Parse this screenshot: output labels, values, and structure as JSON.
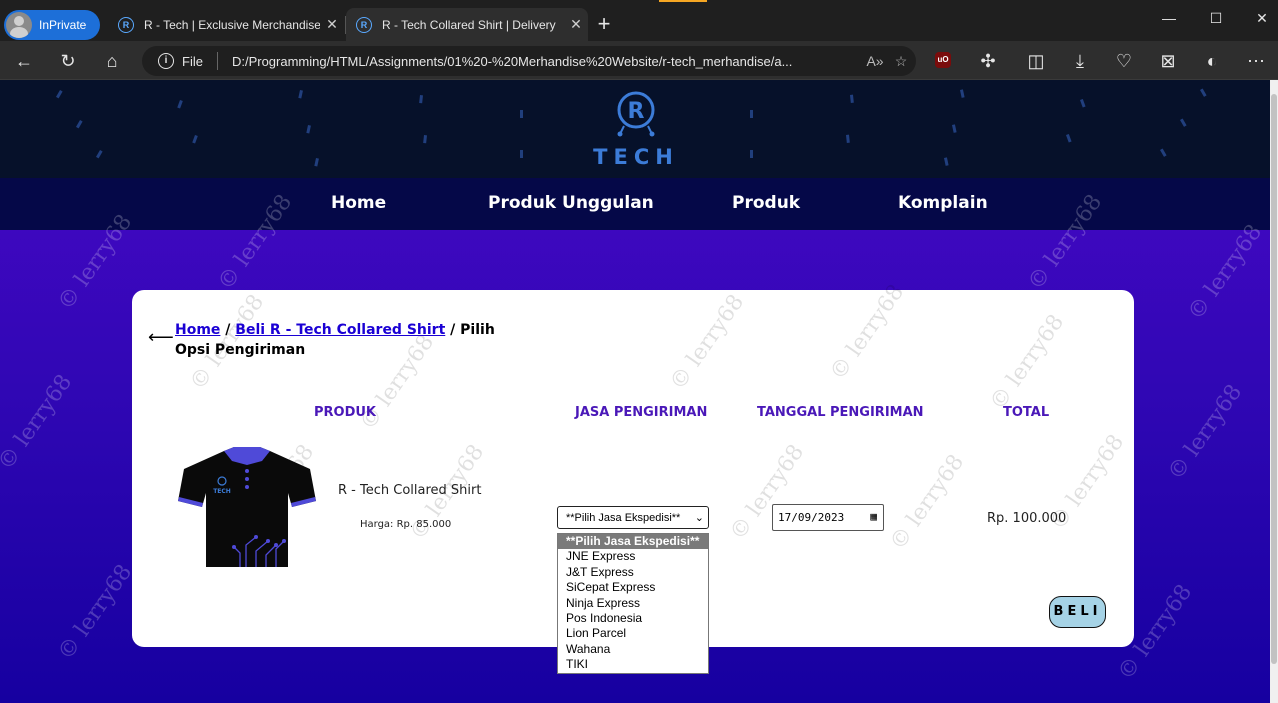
{
  "browser": {
    "inprivate_label": "InPrivate",
    "tabs": [
      {
        "title": "R - Tech | Exclusive Merchandise"
      },
      {
        "title": "R - Tech Collared Shirt | Delivery"
      }
    ],
    "address": {
      "scheme_label": "File",
      "url": "D:/Programming/HTML/Assignments/01%20-%20Merhandise%20Website/r-tech_merhandise/a..."
    }
  },
  "site": {
    "logo_text": "TECH",
    "logo_letter": "R",
    "nav": [
      {
        "label": "Home"
      },
      {
        "label": "Produk Unggulan"
      },
      {
        "label": "Produk"
      },
      {
        "label": "Komplain"
      }
    ]
  },
  "breadcrumb": {
    "home": "Home",
    "sep1": " / ",
    "product": "Beli R - Tech Collared Shirt",
    "sep2": " / ",
    "current": "Pilih Opsi Pengiriman"
  },
  "table": {
    "headers": [
      "PRODUK",
      "JASA PENGIRIMAN",
      "TANGGAL PENGIRIMAN",
      "TOTAL"
    ],
    "product_name": "R - Tech Collared Shirt",
    "price": "Harga: Rp. 85.000",
    "shirt_logo_text": "TECH",
    "shipping_select": {
      "selected": "**Pilih Jasa Ekspedisi**",
      "options": [
        "**Pilih Jasa Ekspedisi**",
        "JNE Express",
        "J&T Express",
        "SiCepat Express",
        "Ninja Express",
        "Pos Indonesia",
        "Lion Parcel",
        "Wahana",
        "TIKI"
      ]
    },
    "date_value": "17/09/2023",
    "total": "Rp. 100.000"
  },
  "buy_button": "BELI",
  "watermark": "© lerry68",
  "colors": {
    "accent": "#4a18b8",
    "link": "#1a00d4",
    "nav_bg": "#050848",
    "button_bg": "#a6d3e6"
  }
}
